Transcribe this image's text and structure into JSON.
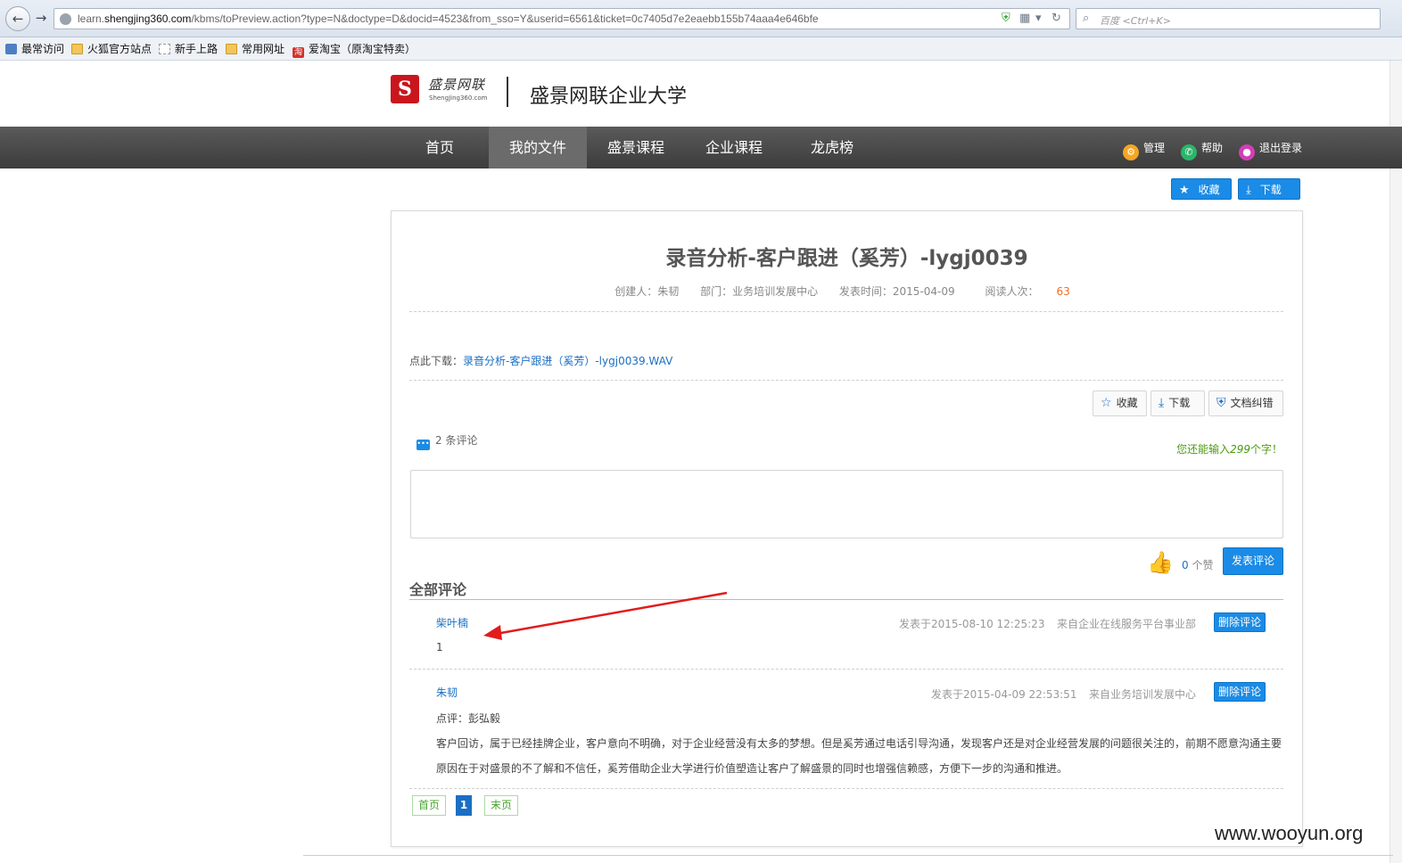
{
  "browser": {
    "url_prefix": "learn.",
    "url_domain": "shengjing360.com",
    "url_rest": "/kbms/toPreview.action?type=N&doctype=D&docid=4523&from_sso=Y&userid=6561&ticket=0c7405d7e2eaebb155b74aaa4e646bfe",
    "search_placeholder": "百度 <Ctrl+K>",
    "bookmarks": [
      "最常访问",
      "火狐官方站点",
      "新手上路",
      "常用网址",
      "爱淘宝（原淘宝特卖）"
    ]
  },
  "header": {
    "logo_script": "盛景网联",
    "logo_sub": "ShengJing360.com",
    "site_title": "盛景网联企业大学"
  },
  "nav": {
    "items": [
      "首页",
      "我的文件",
      "盛景课程",
      "企业课程",
      "龙虎榜"
    ],
    "active": "我的文件",
    "tools": {
      "manage": "管理",
      "help": "帮助",
      "logout": "退出登录"
    }
  },
  "top_actions": {
    "favorite": "收藏",
    "download": "下载"
  },
  "document": {
    "title": "录音分析-客户跟进（奚芳）-lygj0039",
    "creator": "创建人：朱韧",
    "department": "部门：业务培训发展中心",
    "publish_time": "发表时间：2015-04-09",
    "read_label": "阅读人次：",
    "read_count": "63",
    "download_label": "点此下载：",
    "download_file": "录音分析-客户跟进（奚芳）-lygj0039.WAV"
  },
  "doc_tools": {
    "favorite": "收藏",
    "download": "下载",
    "report": "文档纠错"
  },
  "comment_box": {
    "count_text": "2 条评论",
    "hint_prefix": "您还能输入",
    "hint_num": "299",
    "hint_suffix": "个字！",
    "input_value": "",
    "like_count": "0",
    "like_unit": " 个赞",
    "post_label": "发表评论"
  },
  "comments": {
    "heading": "全部评论",
    "items": [
      {
        "author": "柴叶楠",
        "time": "发表于2015-08-10 12:25:23",
        "source": "来自企业在线服务平台事业部",
        "delete_label": "删除评论",
        "text": "1"
      },
      {
        "author": "朱韧",
        "time": "发表于2015-04-09 22:53:51",
        "source": "来自业务培训发展中心",
        "delete_label": "删除评论",
        "reviewer": "点评：彭弘毅",
        "text_line1": "客户回访，属于已经挂牌企业，客户意向不明确，对于企业经营没有太多的梦想。但是奚芳通过电话引导沟通，发现客户还是对企业经营发展的问题很关注的，前期不愿意沟通主要",
        "text_line2": "原因在于对盛景的不了解和不信任，奚芳借助企业大学进行价值塑造让客户了解盛景的同时也增强信赖感，方便下一步的沟通和推进。"
      }
    ]
  },
  "pagination": {
    "first": "首页",
    "current": "1",
    "last": "末页"
  },
  "watermark": "www.wooyun.org",
  "colors": {
    "accent": "#1a8be6",
    "nav_bg": "#4a4a4a",
    "orange": "#f26d1f",
    "green_hint": "#4a9a0f"
  }
}
